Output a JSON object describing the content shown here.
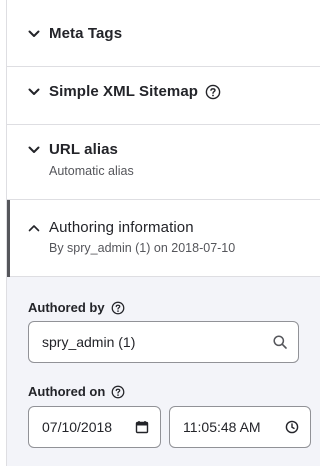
{
  "sections": [
    {
      "title": "Meta Tags",
      "chevron": "chevron-down"
    },
    {
      "title": "Simple XML Sitemap",
      "chevron": "chevron-down",
      "has_help": true
    },
    {
      "title": "URL alias",
      "summary": "Automatic alias",
      "chevron": "chevron-down"
    },
    {
      "title": "Authoring information",
      "summary": "By spry_admin (1) on 2018-07-10",
      "chevron": "chevron-up",
      "expanded": true
    }
  ],
  "authoring": {
    "authored_by_label": "Authored by",
    "authored_by_value": "spry_admin (1)",
    "authored_on_label": "Authored on",
    "date_value": "07/10/2018",
    "time_value": "11:05:48 AM"
  },
  "colors": {
    "text": "#232429",
    "muted": "#55565b",
    "border": "#dedee2",
    "form_background": "#f3f4f9",
    "input_border": "#919297"
  }
}
